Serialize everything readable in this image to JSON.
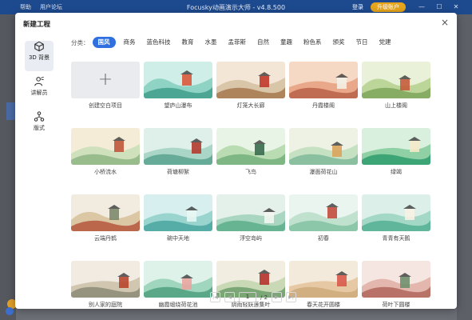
{
  "app": {
    "menu_help": "帮助",
    "menu_forum": "用户论坛",
    "title": "Focusky动画演示大师 - v4.8.500",
    "login": "登录",
    "upgrade": "升级账户"
  },
  "dialog": {
    "title": "新建工程",
    "close": "×"
  },
  "nav": [
    {
      "label": "3D 背景",
      "icon": "cube-icon"
    },
    {
      "label": "讲解员",
      "icon": "presenter-icon"
    },
    {
      "label": "版式",
      "icon": "layout-icon"
    }
  ],
  "categories": {
    "label": "分类：",
    "items": [
      "国风",
      "商务",
      "蓝色科技",
      "教育",
      "水墨",
      "孟菲斯",
      "自然",
      "童趣",
      "粉色系",
      "颁奖",
      "节日",
      "党建"
    ],
    "active": "国风"
  },
  "templates": {
    "blank": "创建空白项目",
    "items": [
      "望庐山瀑布",
      "灯笼大长廊",
      "丹霞楼阁",
      "山上楼阁",
      "小桥流水",
      "荷塘柳絮",
      "飞鸟",
      "瀑面荷花山",
      "绿竭",
      "云端丹鹤",
      "碗中天地",
      "浮空岛屿",
      "初春",
      "青青有天鹅",
      "别人家的庭院",
      "幽霞缎绕荷花池",
      "阴雨轻妖莲集叶",
      "春天花开圆楼",
      "荷叶下圆楼"
    ]
  },
  "pagination": {
    "current": "1",
    "total": "/ 2"
  }
}
